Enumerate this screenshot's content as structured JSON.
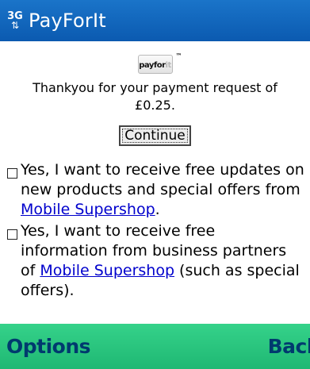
{
  "status_bar": {
    "network": "3G",
    "network_arrows": "⇅",
    "title": "PayForIt"
  },
  "logo": {
    "text_main": "payfor",
    "text_fade": "it",
    "tm": "™"
  },
  "message": {
    "line1": "Thankyou for your payment request of",
    "line2": "£0.25."
  },
  "continue_label": "Continue",
  "options": [
    {
      "text_before": "Yes, I want to receive free updates on new products and special offers from ",
      "link": "Mobile Supershop",
      "text_after": ".",
      "checked": false
    },
    {
      "text_before": "Yes, I want to receive free information from business partners of ",
      "link": "Mobile Supershop",
      "text_after": " (such as special offers).",
      "checked": false
    }
  ],
  "softkeys": {
    "left": "Options",
    "right": "Back"
  },
  "colors": {
    "status_bar": "#0b5ab0",
    "softkey_bar": "#1fb873",
    "softkey_text": "#003a6e",
    "link": "#0000cc"
  }
}
